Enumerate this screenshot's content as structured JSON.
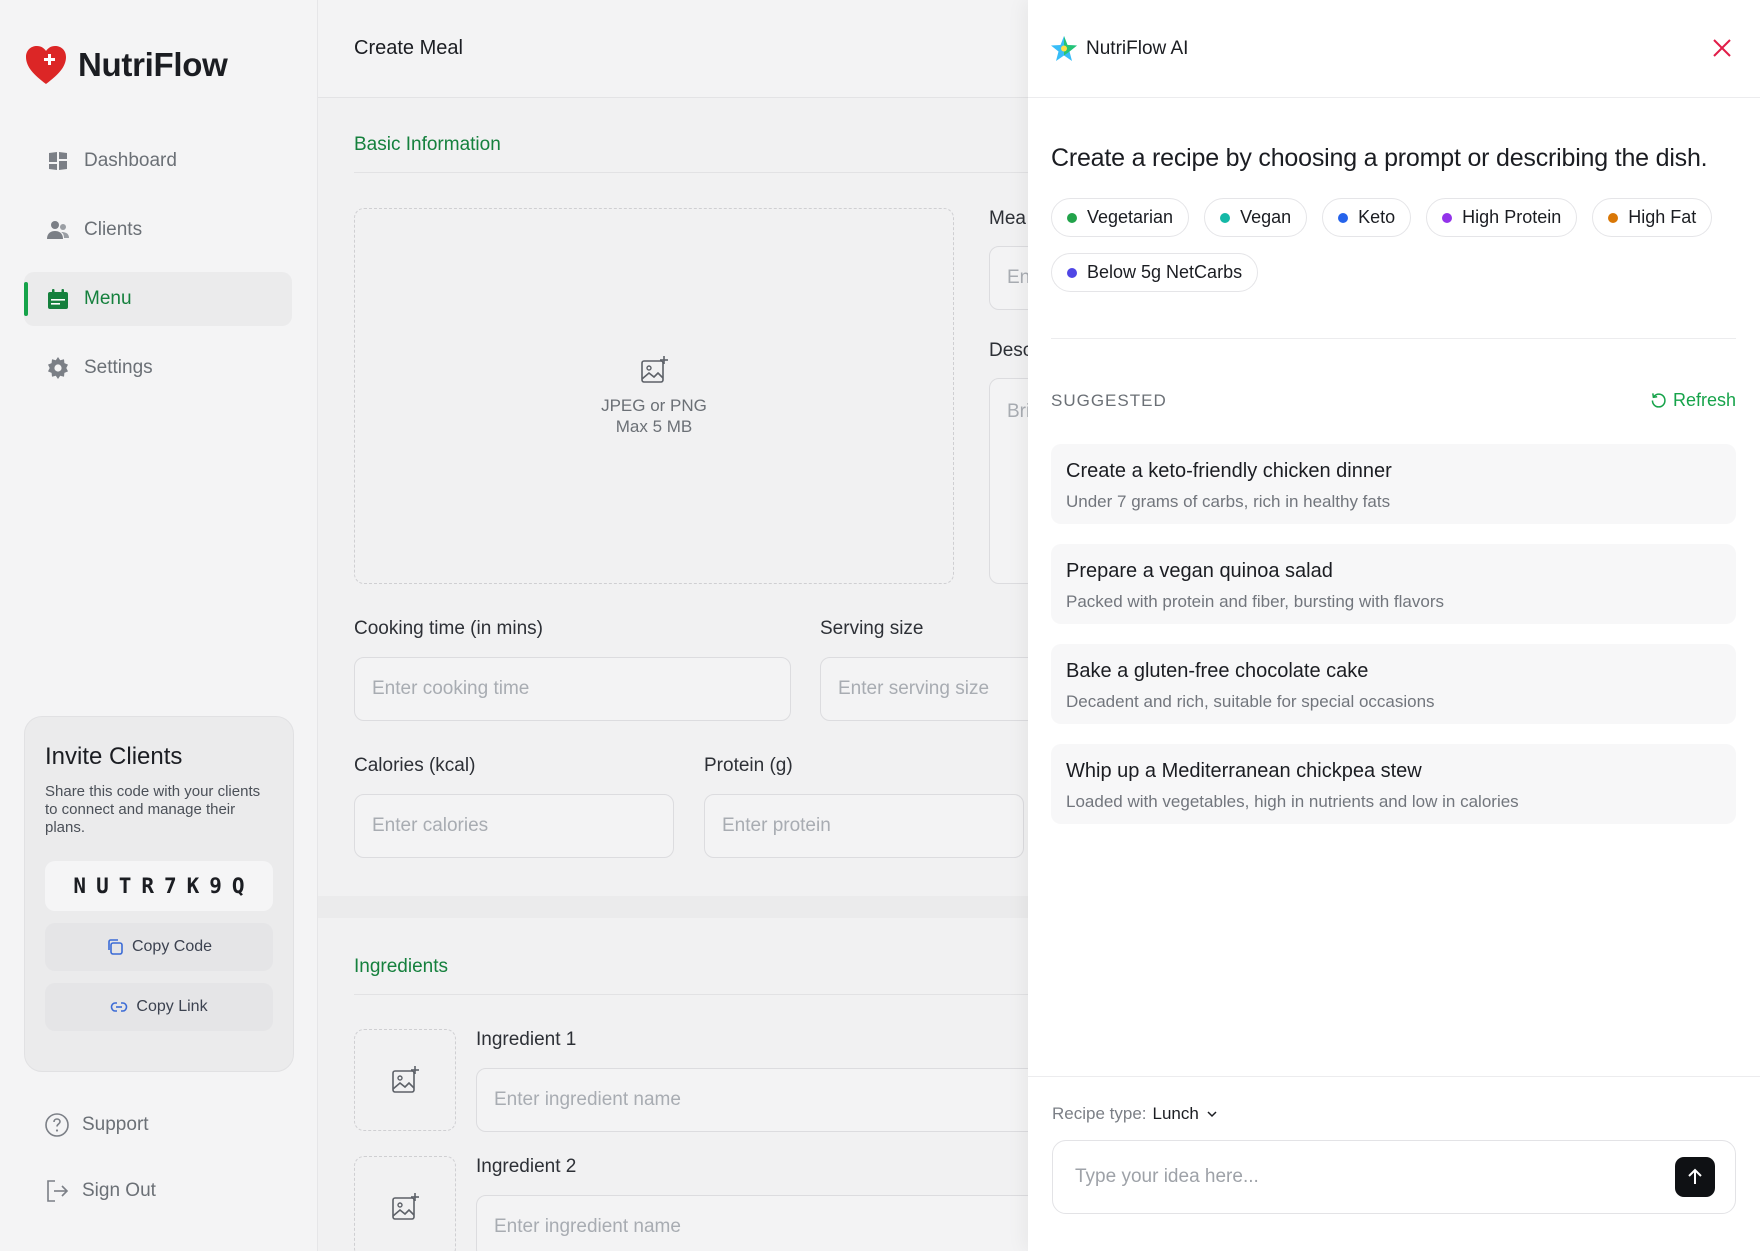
{
  "app": {
    "name": "NutriFlow"
  },
  "sidebar": {
    "items": [
      {
        "label": "Dashboard",
        "icon": "dashboard-icon"
      },
      {
        "label": "Clients",
        "icon": "users-icon"
      },
      {
        "label": "Menu",
        "icon": "calendar-icon",
        "active": true
      },
      {
        "label": "Settings",
        "icon": "gear-icon"
      }
    ],
    "invite": {
      "title": "Invite Clients",
      "description": "Share this code with your clients to connect and manage their plans.",
      "code": "NUTR7K9Q",
      "copy_code_label": "Copy Code",
      "copy_link_label": "Copy Link"
    },
    "support_label": "Support",
    "signout_label": "Sign Out"
  },
  "main": {
    "header_title": "Create Meal",
    "basic_info_title": "Basic Information",
    "upload_line1": "JPEG or PNG",
    "upload_line2": "Max 5 MB",
    "meal_name_label": "Mea",
    "meal_name_placeholder": "En",
    "description_label": "Desc",
    "description_placeholder": "Bri",
    "cooking_time_label": "Cooking time (in mins)",
    "cooking_time_placeholder": "Enter cooking time",
    "serving_size_label": "Serving size",
    "serving_size_placeholder": "Enter serving size",
    "calories_label": "Calories (kcal)",
    "calories_placeholder": "Enter calories",
    "protein_label": "Protein (g)",
    "protein_placeholder": "Enter protein",
    "ingredients_title": "Ingredients",
    "ingredients": [
      {
        "label": "Ingredient 1",
        "placeholder": "Enter ingredient name"
      },
      {
        "label": "Ingredient 2",
        "placeholder": "Enter ingredient name"
      }
    ]
  },
  "ai_panel": {
    "title": "NutriFlow AI",
    "heading": "Create a recipe by choosing a prompt or describing the dish.",
    "chips": [
      {
        "label": "Vegetarian",
        "color": "#22a34a"
      },
      {
        "label": "Vegan",
        "color": "#14b8a6"
      },
      {
        "label": "Keto",
        "color": "#2563eb"
      },
      {
        "label": "High Protein",
        "color": "#9333ea"
      },
      {
        "label": "High Fat",
        "color": "#d97706"
      },
      {
        "label": "Below 5g NetCarbs",
        "color": "#4f46e5"
      }
    ],
    "suggested_label": "SUGGESTED",
    "refresh_label": "Refresh",
    "suggestions": [
      {
        "title": "Create a keto-friendly chicken dinner",
        "subtitle": "Under 7 grams of carbs, rich in healthy fats"
      },
      {
        "title": "Prepare a vegan quinoa salad",
        "subtitle": "Packed with protein and fiber, bursting with flavors"
      },
      {
        "title": "Bake a gluten-free chocolate cake",
        "subtitle": "Decadent and rich, suitable for special occasions"
      },
      {
        "title": "Whip up a Mediterranean chickpea stew",
        "subtitle": "Loaded with vegetables, high in nutrients and low in calories"
      }
    ],
    "recipe_type_label": "Recipe type:",
    "recipe_type_value": "Lunch",
    "input_placeholder": "Type your idea here..."
  },
  "colors": {
    "accent": "#16a34a",
    "brand_heart": "#dc2626",
    "close": "#e11d48"
  }
}
